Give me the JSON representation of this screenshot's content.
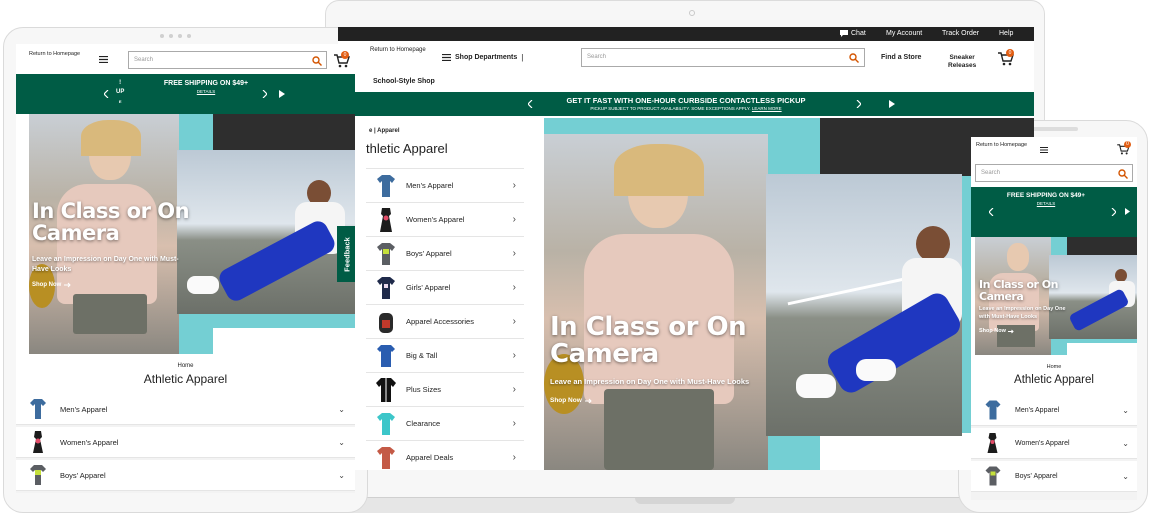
{
  "laptop": {
    "topbar": {
      "chat": "Chat",
      "my_account": "My Account",
      "track_order": "Track Order",
      "help": "Help"
    },
    "header": {
      "return_home": "Return to Homepage",
      "shop_departments": "Shop Departments",
      "search_placeholder": "Search",
      "find_store": "Find a Store",
      "sneaker_line1": "Sneaker",
      "sneaker_line2": "Releases",
      "cart_count": "0"
    },
    "subnav": "School-Style Shop",
    "promo": {
      "title": "GET IT FAST WITH ONE-HOUR CURBSIDE CONTACTLESS PICKUP",
      "sub": "PICKUP SUBJECT TO PRODUCT AVAILABILITY. SOME EXCEPTIONS APPLY.",
      "details": "LEARN MORE"
    },
    "breadcrumb": {
      "home": "e",
      "current": "Apparel"
    },
    "heading": "thletic Apparel",
    "categories": [
      "Men's Apparel",
      "Women's Apparel",
      "Boys' Apparel",
      "Girls' Apparel",
      "Apparel Accessories",
      "Big & Tall",
      "Plus Sizes",
      "Clearance",
      "Apparel Deals"
    ],
    "hero": {
      "title_line1": "In Class or On",
      "title_line2": "Camera",
      "subtitle": "Leave an Impression on Day One with Must-Have Looks",
      "cta": "Shop Now"
    }
  },
  "tablet": {
    "header": {
      "return_home": "Return to Homepage",
      "search_placeholder": "Search",
      "cart_count": "0"
    },
    "promo": {
      "left_top": "!",
      "left_mid": "UP",
      "left_bottom": "E",
      "title": "FREE SHIPPING ON $49+",
      "details": "DETAILS"
    },
    "hero": {
      "title_line1": "In Class or On",
      "title_line2": "Camera",
      "subtitle_line1": "Leave an Impression on Day One with Must-",
      "subtitle_line2": "Have Looks",
      "cta": "Shop Now"
    },
    "feedback": "Feedback",
    "breadcrumb": "Home",
    "heading": "Athletic Apparel",
    "categories": [
      "Men's Apparel",
      "Women's Apparel",
      "Boys' Apparel"
    ]
  },
  "phone": {
    "header": {
      "return_home": "Return to Homepage",
      "search_placeholder": "Search",
      "cart_count": "0"
    },
    "promo": {
      "title": "FREE SHIPPING ON $49+",
      "details": "DETAILS"
    },
    "hero": {
      "title_line1": "In Class or On",
      "title_line2": "Camera",
      "subtitle_line1": "Leave an Impression on Day One",
      "subtitle_line2": "with Must-Have Looks",
      "cta": "Shop Now"
    },
    "breadcrumb": "Home",
    "heading": "Athletic Apparel",
    "categories": [
      "Men's Apparel",
      "Women's Apparel",
      "Boys' Apparel"
    ]
  },
  "colors": {
    "brand_green": "#005c45",
    "accent_teal": "#74cfd3",
    "cart_badge": "#e25d12",
    "topbar": "#222222"
  },
  "icons": [
    "chat-icon",
    "hamburger-icon",
    "search-icon",
    "cart-icon",
    "chevron-left-icon",
    "chevron-right-icon",
    "play-icon",
    "chevron-down-icon",
    "arrow-right-icon"
  ]
}
